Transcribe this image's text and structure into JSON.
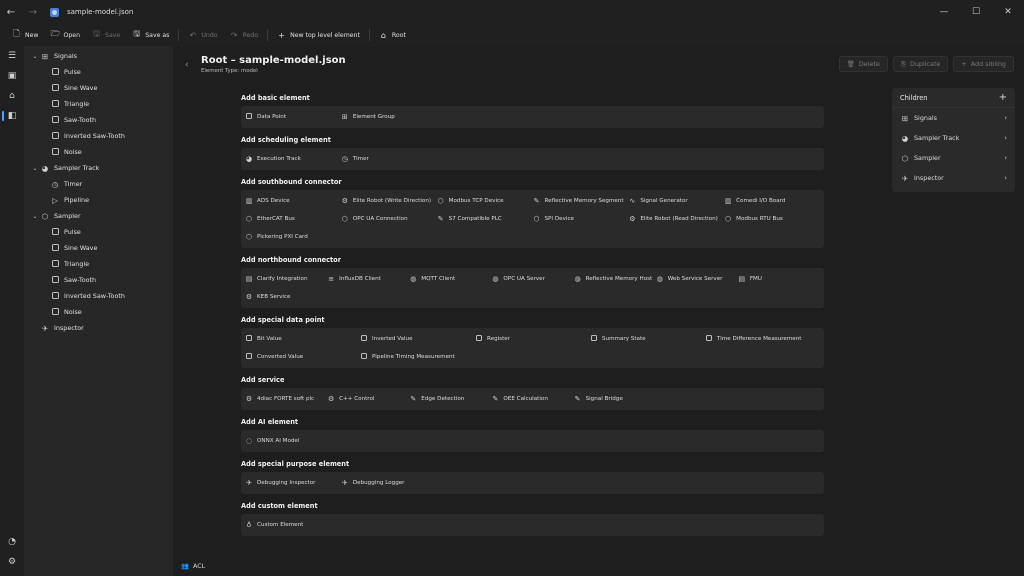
{
  "window": {
    "title": "sample-model.json",
    "back_icon": "arrow-left-icon",
    "forward_icon": "arrow-right-icon"
  },
  "window_controls": {
    "minimize": "—",
    "maximize": "☐",
    "close": "✕"
  },
  "toolbar": {
    "new": "New",
    "open": "Open",
    "save": "Save",
    "save_as": "Save as",
    "undo": "Undo",
    "redo": "Redo",
    "new_top": "New top level element",
    "root": "Root"
  },
  "tree": [
    {
      "label": "Signals",
      "level": 0,
      "expanded": true,
      "icon": "grid-icon"
    },
    {
      "label": "Pulse",
      "level": 1,
      "icon": "square-icon"
    },
    {
      "label": "Sine Wave",
      "level": 1,
      "icon": "square-icon"
    },
    {
      "label": "Triangle",
      "level": 1,
      "icon": "square-icon"
    },
    {
      "label": "Saw-Tooth",
      "level": 1,
      "icon": "square-icon"
    },
    {
      "label": "Inverted Saw-Tooth",
      "level": 1,
      "icon": "square-icon"
    },
    {
      "label": "Noise",
      "level": 1,
      "icon": "square-icon"
    },
    {
      "label": "Sampler Track",
      "level": 0,
      "expanded": true,
      "icon": "track-icon"
    },
    {
      "label": "Timer",
      "level": 1,
      "icon": "timer-icon"
    },
    {
      "label": "Pipeline",
      "level": 1,
      "icon": "play-icon"
    },
    {
      "label": "Sampler",
      "level": 0,
      "expanded": true,
      "icon": "cube-icon"
    },
    {
      "label": "Pulse",
      "level": 1,
      "icon": "square-icon"
    },
    {
      "label": "Sine Wave",
      "level": 1,
      "icon": "square-icon"
    },
    {
      "label": "Triangle",
      "level": 1,
      "icon": "square-icon"
    },
    {
      "label": "Saw-Tooth",
      "level": 1,
      "icon": "square-icon"
    },
    {
      "label": "Inverted Saw-Tooth",
      "level": 1,
      "icon": "square-icon"
    },
    {
      "label": "Noise",
      "level": 1,
      "icon": "square-icon"
    },
    {
      "label": "Inspector",
      "level": 0,
      "icon": "rocket-icon"
    }
  ],
  "header": {
    "title": "Root – sample-model.json",
    "subtitle": "Element Type: model"
  },
  "actions": {
    "delete": "Delete",
    "duplicate": "Duplicate",
    "add_sibling": "Add sibling"
  },
  "sections": {
    "basic": {
      "title": "Add basic element",
      "items": [
        "Data Point",
        "Element Group"
      ]
    },
    "scheduling": {
      "title": "Add scheduling element",
      "items": [
        "Execution Track",
        "Timer"
      ]
    },
    "southbound": {
      "title": "Add southbound connector",
      "items": [
        "ADS Device",
        "Elite Robot (Write Direction)",
        "Modbus TCP Device",
        "Reflective Memory Segment",
        "Signal Generator",
        "Comedi I/O Board",
        "EtherCAT Bus",
        "OPC UA Connection",
        "S7 Compatible PLC",
        "SPI Device",
        "Elite Robot (Read Direction)",
        "Modbus RTU Bus",
        "Pickering PXI Card"
      ]
    },
    "northbound": {
      "title": "Add northbound connector",
      "items": [
        "Clarify Integration",
        "InfluxDB Client",
        "MQTT Client",
        "OPC UA Server",
        "Reflective Memory Host",
        "Web Service Server",
        "FMU",
        "KEB Service"
      ]
    },
    "special_dp": {
      "title": "Add special data point",
      "items": [
        "Bit Value",
        "Inverted Value",
        "Register",
        "Summary State",
        "Time Difference Measurement",
        "Converted Value",
        "Pipeline Timing Measurement"
      ]
    },
    "service": {
      "title": "Add service",
      "items": [
        "4diac FORTE soft plc",
        "C++ Control",
        "Edge Detection",
        "OEE Calculation",
        "Signal Bridge"
      ]
    },
    "ai": {
      "title": "Add AI element",
      "items": [
        "ONNX AI Model"
      ]
    },
    "special_purpose": {
      "title": "Add special purpose element",
      "items": [
        "Debugging Inspector",
        "Debugging Logger"
      ]
    },
    "custom": {
      "title": "Add custom element",
      "items": [
        "Custom Element"
      ]
    }
  },
  "children": {
    "title": "Children",
    "items": [
      {
        "label": "Signals",
        "icon": "grid-icon"
      },
      {
        "label": "Sampler Track",
        "icon": "track-icon"
      },
      {
        "label": "Sampler",
        "icon": "cube-icon"
      },
      {
        "label": "Inspector",
        "icon": "rocket-icon"
      }
    ]
  },
  "footer": {
    "acl": "ACL"
  }
}
